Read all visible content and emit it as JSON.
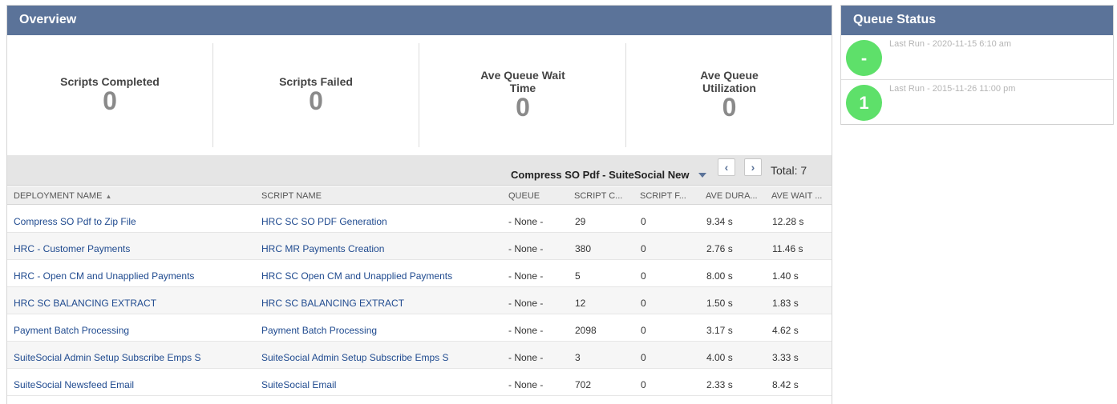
{
  "overview": {
    "title": "Overview",
    "stats": [
      {
        "label_line1": "Scripts Completed",
        "label_line2": "",
        "value": "0"
      },
      {
        "label_line1": "Scripts Failed",
        "label_line2": "",
        "value": "0"
      },
      {
        "label_line1": "Ave Queue Wait",
        "label_line2": "Time",
        "value": "0"
      },
      {
        "label_line1": "Ave Queue",
        "label_line2": "Utilization",
        "value": "0"
      }
    ],
    "filter_selected": "Compress SO Pdf - SuiteSocial New",
    "total": "Total: 7",
    "pager": {
      "prev": "‹",
      "next": "›"
    },
    "columns": [
      "DEPLOYMENT NAME",
      "SCRIPT NAME",
      "QUEUE",
      "SCRIPT C...",
      "SCRIPT F...",
      "AVE DURA...",
      "AVE WAIT ..."
    ],
    "sort_indicator": "▲",
    "rows": [
      {
        "deployment": "Compress SO Pdf to Zip File",
        "script": "HRC SC SO PDF Generation",
        "queue": "- None -",
        "completed": "29",
        "failed": "0",
        "duration": "9.34 s",
        "wait": "12.28 s"
      },
      {
        "deployment": "HRC - Customer Payments",
        "script": "HRC MR Payments Creation",
        "queue": "- None -",
        "completed": "380",
        "failed": "0",
        "duration": "2.76 s",
        "wait": "11.46 s"
      },
      {
        "deployment": "HRC - Open CM and Unapplied Payments",
        "script": "HRC SC Open CM and Unapplied Payments",
        "queue": "- None -",
        "completed": "5",
        "failed": "0",
        "duration": "8.00 s",
        "wait": "1.40 s"
      },
      {
        "deployment": "HRC SC BALANCING EXTRACT",
        "script": "HRC SC BALANCING EXTRACT",
        "queue": "- None -",
        "completed": "12",
        "failed": "0",
        "duration": "1.50 s",
        "wait": "1.83 s"
      },
      {
        "deployment": "Payment Batch Processing",
        "script": "Payment Batch Processing",
        "queue": "- None -",
        "completed": "2098",
        "failed": "0",
        "duration": "3.17 s",
        "wait": "4.62 s"
      },
      {
        "deployment": "SuiteSocial Admin Setup Subscribe Emps S",
        "script": "SuiteSocial Admin Setup Subscribe Emps S",
        "queue": "- None -",
        "completed": "3",
        "failed": "0",
        "duration": "4.00 s",
        "wait": "3.33 s"
      },
      {
        "deployment": "SuiteSocial Newsfeed Email",
        "script": "SuiteSocial Email",
        "queue": "- None -",
        "completed": "702",
        "failed": "0",
        "duration": "2.33 s",
        "wait": "8.42 s"
      }
    ]
  },
  "queue_status": {
    "title": "Queue Status",
    "items": [
      {
        "badge": "-",
        "last_run": "Last Run - 2020-11-15 6:10 am"
      },
      {
        "badge": "1",
        "last_run": "Last Run - 2015-11-26 11:00 pm"
      }
    ],
    "badge_color": "#5ee06a"
  },
  "colors": {
    "header": "#5b7399",
    "link": "#1f4a8f"
  }
}
